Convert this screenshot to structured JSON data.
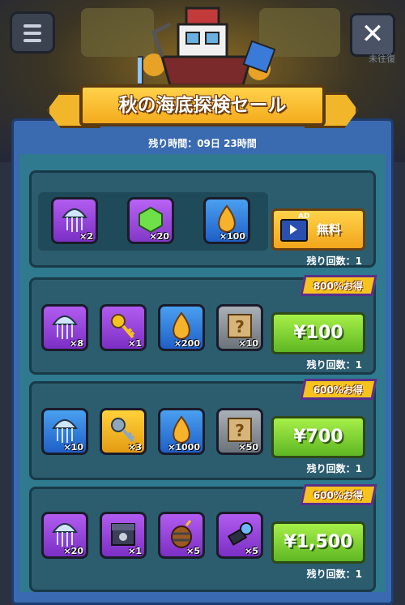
{
  "header": {
    "title": "秋の海底探検セール",
    "timer_text": "残り時間：09日 23時間",
    "close_label": "✕",
    "background_label": "未往復"
  },
  "packs": [
    {
      "items": [
        {
          "icon": "jellyfish-icon",
          "qty": "×2"
        },
        {
          "icon": "green-gem-icon",
          "qty": "×20"
        },
        {
          "icon": "fuel-drop-icon",
          "qty": "×100"
        }
      ],
      "button_label": "無料",
      "ad_label": "AD",
      "remaining": "残り回数：1"
    },
    {
      "badge": "800%お得",
      "items": [
        {
          "icon": "jellyfish-icon",
          "qty": "×8"
        },
        {
          "icon": "key-icon",
          "qty": "×1"
        },
        {
          "icon": "fuel-drop-icon",
          "qty": "×200"
        },
        {
          "icon": "mystery-map-icon",
          "qty": "×10"
        }
      ],
      "button_label": "¥100",
      "remaining": "残り回数：1"
    },
    {
      "badge": "600%お得",
      "items": [
        {
          "icon": "jellyfish-icon",
          "qty": "×10"
        },
        {
          "icon": "key-icon",
          "qty": "×3"
        },
        {
          "icon": "fuel-drop-icon",
          "qty": "×1000"
        },
        {
          "icon": "mystery-map-icon",
          "qty": "×50"
        }
      ],
      "button_label": "¥700",
      "remaining": "残り回数：1"
    },
    {
      "badge": "600%お得",
      "items": [
        {
          "icon": "jellyfish-icon",
          "qty": "×20"
        },
        {
          "icon": "chest-icon",
          "qty": "×1"
        },
        {
          "icon": "bomb-barrel-icon",
          "qty": "×5"
        },
        {
          "icon": "flashlight-icon",
          "qty": "×5"
        }
      ],
      "button_label": "¥1,500",
      "remaining": "残り回数：1"
    }
  ]
}
